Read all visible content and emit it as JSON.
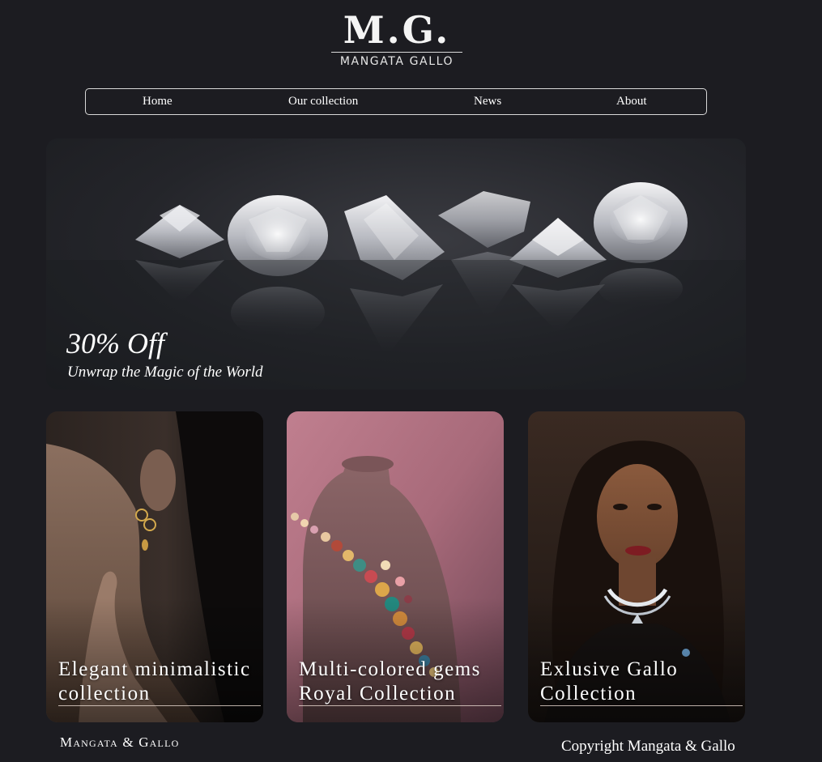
{
  "brand": {
    "monogram": "M.G.",
    "name": "MANGATA GALLO"
  },
  "nav": {
    "items": [
      {
        "label": "Home"
      },
      {
        "label": "Our collection"
      },
      {
        "label": "News"
      },
      {
        "label": "About"
      }
    ]
  },
  "hero": {
    "title": "30% Off",
    "subtitle": "Unwrap the Magic of the World"
  },
  "collections": [
    {
      "label": "Elegant minimalistic collection"
    },
    {
      "label": "Multi-colored gems Royal Collection"
    },
    {
      "label": "Exlusive Gallo Collection"
    }
  ],
  "footer": {
    "brand": "Mangata & Gallo",
    "copyright": "Copyright Mangata & Gallo"
  },
  "colors": {
    "background": "#1c1c21",
    "text": "#ffffff",
    "nav_border": "#d8d8d8"
  }
}
